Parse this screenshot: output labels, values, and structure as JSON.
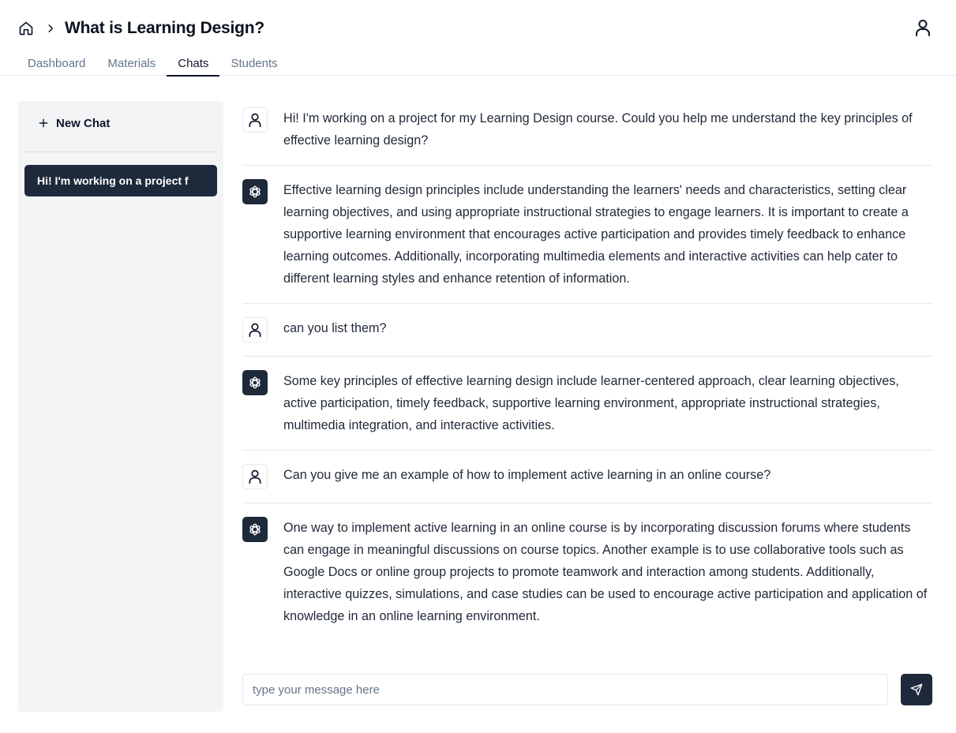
{
  "header": {
    "title": "What is Learning Design?",
    "icons": {
      "home": "home-icon",
      "breadcrumb_separator": "chevron-right-icon",
      "account": "user-icon"
    }
  },
  "tabs": [
    {
      "label": "Dashboard",
      "active": false
    },
    {
      "label": "Materials",
      "active": false
    },
    {
      "label": "Chats",
      "active": true
    },
    {
      "label": "Students",
      "active": false
    }
  ],
  "sidebar": {
    "new_chat_label": "New Chat",
    "chats": [
      {
        "label": "Hi! I'm working on a project f",
        "active": true
      }
    ]
  },
  "messages": [
    {
      "role": "user",
      "text": "Hi! I'm working on a project for my Learning Design course. Could you help me understand the key principles of effective learning design?"
    },
    {
      "role": "assistant",
      "text": "Effective learning design principles include understanding the learners' needs and characteristics, setting clear learning objectives, and using appropriate instructional strategies to engage learners. It is important to create a supportive learning environment that encourages active participation and provides timely feedback to enhance learning outcomes. Additionally, incorporating multimedia elements and interactive activities can help cater to different learning styles and enhance retention of information."
    },
    {
      "role": "user",
      "text": "can you list them?"
    },
    {
      "role": "assistant",
      "text": "Some key principles of effective learning design include learner-centered approach, clear learning objectives, active participation, timely feedback, supportive learning environment, appropriate instructional strategies, multimedia integration, and interactive activities."
    },
    {
      "role": "user",
      "text": "Can you give me an example of how to implement active learning in an online course?"
    },
    {
      "role": "assistant",
      "text": "One way to implement active learning in an online course is by incorporating discussion forums where students can engage in meaningful discussions on course topics. Another example is to use collaborative tools such as Google Docs or online group projects to promote teamwork and interaction among students. Additionally, interactive quizzes, simulations, and case studies can be used to encourage active participation and application of knowledge in an online learning environment."
    }
  ],
  "composer": {
    "placeholder": "type your message here",
    "value": "",
    "send_icon": "send-icon"
  },
  "colors": {
    "primary_dark": "#1e293b",
    "sidebar_bg": "#f3f4f6",
    "muted_text": "#64748b",
    "border": "#e5e7eb"
  }
}
